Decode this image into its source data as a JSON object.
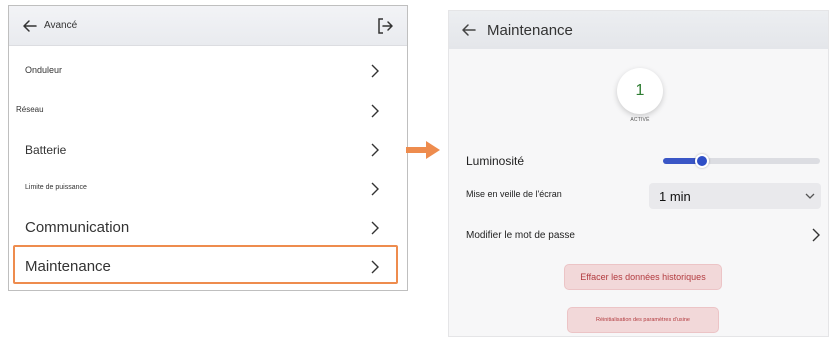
{
  "left": {
    "header": {
      "title": "Avancé",
      "back_icon": "arrow-left-icon",
      "logout_icon": "logout-icon"
    },
    "menu": [
      {
        "label": "Onduleur"
      },
      {
        "label": "Réseau"
      },
      {
        "label": "Batterie"
      },
      {
        "label": "Limite de puissance"
      },
      {
        "label": "Communication"
      },
      {
        "label": "Maintenance"
      }
    ],
    "highlight_color": "#ee8c4e"
  },
  "arrow_color": "#ee8c4e",
  "right": {
    "header": {
      "title": "Maintenance",
      "back_icon": "arrow-left-icon"
    },
    "status": {
      "value": "1",
      "label": "ACTIVÉ",
      "value_color": "#2e7d32"
    },
    "brightness": {
      "label": "Luminosité",
      "level": 0.25,
      "accent": "#3a56c6"
    },
    "sleep": {
      "label": "Mise en veille de l'écran",
      "value": "1 min"
    },
    "password": {
      "label": "Modifier le mot de passe"
    },
    "buttons": {
      "clear_history": "Effacer les données historiques",
      "factory_reset": "Réinitialisation des paramètres d'usine"
    },
    "danger_color": "#b23b3f"
  }
}
